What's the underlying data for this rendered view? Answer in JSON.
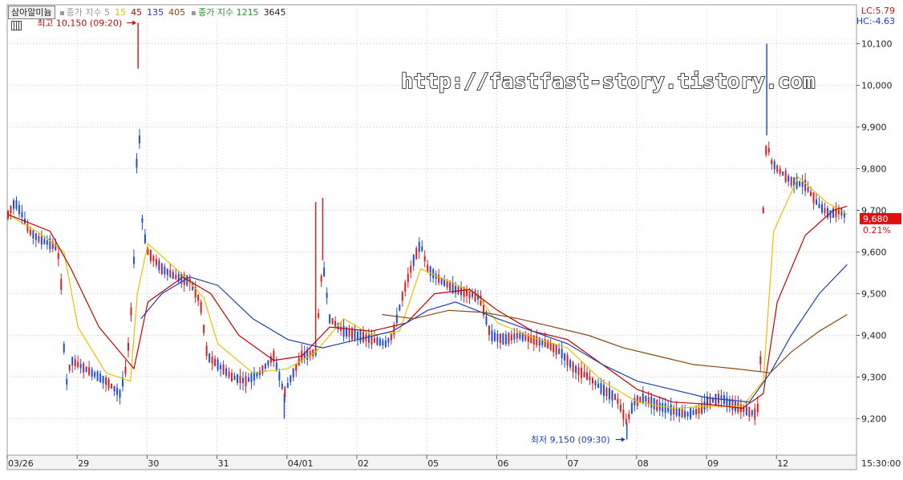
{
  "legend": {
    "symbol": "삼아알미늄",
    "items": [
      {
        "label": "종가 지수 5",
        "color": "#9a9a9a"
      },
      {
        "label": "15",
        "color": "#e6b800"
      },
      {
        "label": "45",
        "color": "#c00000"
      },
      {
        "label": "135",
        "color": "#1f3fb0"
      },
      {
        "label": "405",
        "color": "#8b4513"
      },
      {
        "label": "종가 지수 1215",
        "color": "#2e8b2e"
      },
      {
        "label": "3645",
        "color": "#222222"
      }
    ]
  },
  "indicators": {
    "lc": "LC:5.79",
    "hc": "HC:-4.63"
  },
  "current": {
    "price": "9,680",
    "change": "0.21%"
  },
  "annotations": {
    "high": "최고 10,150 (09:20)",
    "low": "최저 9,150 (09:30)"
  },
  "watermark": "http://fastfast-story.tistory.com",
  "time_label": "15:30:00",
  "colors": {
    "candle_up": "#d42020",
    "candle_down": "#1f4fd0",
    "ma5": "#b8860b",
    "ma15": "#e6c000",
    "ma45": "#c00000",
    "ma135": "#1f3fb0",
    "ma405": "#8b4513",
    "grid": "#c8c8c8",
    "price_box": "#e01010"
  },
  "chart_data": {
    "type": "line",
    "title": "",
    "xlabel": "",
    "ylabel": "",
    "ylim": [
      9130,
      10150
    ],
    "yticks": [
      "9,200",
      "9,300",
      "9,400",
      "9,500",
      "9,600",
      "9,700",
      "9,800",
      "9,900",
      "10,000",
      "10,100"
    ],
    "ytick_values": [
      9200,
      9300,
      9400,
      9500,
      9600,
      9700,
      9800,
      9900,
      10000,
      10100
    ],
    "xticks": [
      "03/26",
      "29",
      "30",
      "31",
      "04/01",
      "02",
      "05",
      "06",
      "07",
      "08",
      "09",
      "12"
    ],
    "xtick_positions": [
      0,
      1,
      2,
      3,
      4,
      5,
      6,
      7,
      8,
      9,
      10,
      11
    ],
    "x_end": 12.0,
    "grid": true,
    "price": [
      [
        0.0,
        9690
      ],
      [
        0.1,
        9720
      ],
      [
        0.2,
        9690
      ],
      [
        0.3,
        9650
      ],
      [
        0.45,
        9630
      ],
      [
        0.6,
        9620
      ],
      [
        0.7,
        9610
      ],
      [
        0.75,
        9560
      ],
      [
        0.8,
        9370
      ],
      [
        0.83,
        9280
      ],
      [
        0.9,
        9340
      ],
      [
        1.0,
        9330
      ],
      [
        1.2,
        9310
      ],
      [
        1.4,
        9290
      ],
      [
        1.6,
        9260
      ],
      [
        1.7,
        9330
      ],
      [
        1.78,
        9500
      ],
      [
        1.83,
        9700
      ],
      [
        1.86,
        10040
      ],
      [
        1.9,
        9700
      ],
      [
        1.95,
        9640
      ],
      [
        2.0,
        9600
      ],
      [
        2.2,
        9560
      ],
      [
        2.4,
        9540
      ],
      [
        2.6,
        9530
      ],
      [
        2.75,
        9480
      ],
      [
        2.85,
        9350
      ],
      [
        3.0,
        9330
      ],
      [
        3.2,
        9300
      ],
      [
        3.4,
        9290
      ],
      [
        3.6,
        9310
      ],
      [
        3.8,
        9350
      ],
      [
        3.95,
        9260
      ],
      [
        4.05,
        9300
      ],
      [
        4.2,
        9350
      ],
      [
        4.4,
        9360
      ],
      [
        4.5,
        9580
      ],
      [
        4.6,
        9440
      ],
      [
        4.8,
        9410
      ],
      [
        5.0,
        9400
      ],
      [
        5.2,
        9390
      ],
      [
        5.4,
        9380
      ],
      [
        5.5,
        9400
      ],
      [
        5.65,
        9500
      ],
      [
        5.8,
        9580
      ],
      [
        5.9,
        9620
      ],
      [
        6.0,
        9560
      ],
      [
        6.2,
        9530
      ],
      [
        6.4,
        9510
      ],
      [
        6.6,
        9500
      ],
      [
        6.75,
        9490
      ],
      [
        6.9,
        9400
      ],
      [
        7.1,
        9390
      ],
      [
        7.3,
        9400
      ],
      [
        7.5,
        9390
      ],
      [
        7.7,
        9380
      ],
      [
        7.9,
        9360
      ],
      [
        8.1,
        9320
      ],
      [
        8.3,
        9300
      ],
      [
        8.5,
        9270
      ],
      [
        8.7,
        9250
      ],
      [
        8.85,
        9190
      ],
      [
        8.95,
        9240
      ],
      [
        9.1,
        9250
      ],
      [
        9.3,
        9230
      ],
      [
        9.5,
        9220
      ],
      [
        9.7,
        9210
      ],
      [
        9.9,
        9220
      ],
      [
        10.0,
        9240
      ],
      [
        10.2,
        9250
      ],
      [
        10.4,
        9230
      ],
      [
        10.55,
        9220
      ],
      [
        10.7,
        9210
      ],
      [
        10.75,
        9250
      ],
      [
        10.8,
        9700
      ],
      [
        10.85,
        9880
      ],
      [
        10.9,
        9820
      ],
      [
        11.0,
        9800
      ],
      [
        11.2,
        9770
      ],
      [
        11.4,
        9760
      ],
      [
        11.6,
        9710
      ],
      [
        11.75,
        9690
      ],
      [
        11.9,
        9700
      ],
      [
        12.0,
        9680
      ]
    ],
    "series": [
      {
        "name": "15",
        "color": "#e6c000",
        "points": [
          [
            0.0,
            9690
          ],
          [
            0.5,
            9640
          ],
          [
            0.8,
            9600
          ],
          [
            1.0,
            9420
          ],
          [
            1.4,
            9310
          ],
          [
            1.75,
            9290
          ],
          [
            1.85,
            9500
          ],
          [
            2.0,
            9620
          ],
          [
            2.5,
            9545
          ],
          [
            2.8,
            9490
          ],
          [
            3.0,
            9380
          ],
          [
            3.5,
            9310
          ],
          [
            4.0,
            9320
          ],
          [
            4.4,
            9360
          ],
          [
            4.8,
            9440
          ],
          [
            5.2,
            9400
          ],
          [
            5.6,
            9410
          ],
          [
            5.9,
            9560
          ],
          [
            6.3,
            9530
          ],
          [
            6.7,
            9500
          ],
          [
            7.0,
            9430
          ],
          [
            7.5,
            9395
          ],
          [
            8.0,
            9370
          ],
          [
            8.5,
            9290
          ],
          [
            9.0,
            9240
          ],
          [
            9.5,
            9225
          ],
          [
            10.0,
            9230
          ],
          [
            10.5,
            9230
          ],
          [
            10.8,
            9290
          ],
          [
            10.95,
            9650
          ],
          [
            11.3,
            9780
          ],
          [
            11.7,
            9720
          ],
          [
            12.0,
            9690
          ]
        ]
      },
      {
        "name": "45",
        "color": "#c00000",
        "points": [
          [
            0.0,
            9690
          ],
          [
            0.6,
            9650
          ],
          [
            0.9,
            9560
          ],
          [
            1.3,
            9420
          ],
          [
            1.8,
            9320
          ],
          [
            2.0,
            9480
          ],
          [
            2.5,
            9540
          ],
          [
            2.9,
            9500
          ],
          [
            3.3,
            9400
          ],
          [
            3.8,
            9340
          ],
          [
            4.2,
            9350
          ],
          [
            4.6,
            9420
          ],
          [
            5.2,
            9410
          ],
          [
            5.7,
            9430
          ],
          [
            6.1,
            9500
          ],
          [
            6.6,
            9510
          ],
          [
            7.0,
            9460
          ],
          [
            7.5,
            9410
          ],
          [
            8.0,
            9390
          ],
          [
            8.5,
            9330
          ],
          [
            9.0,
            9270
          ],
          [
            9.5,
            9240
          ],
          [
            10.0,
            9235
          ],
          [
            10.5,
            9225
          ],
          [
            10.8,
            9260
          ],
          [
            11.0,
            9480
          ],
          [
            11.4,
            9640
          ],
          [
            11.8,
            9700
          ],
          [
            12.0,
            9710
          ]
        ]
      },
      {
        "name": "135",
        "color": "#1f3fb0",
        "points": [
          [
            1.9,
            9440
          ],
          [
            2.2,
            9500
          ],
          [
            2.6,
            9540
          ],
          [
            3.0,
            9520
          ],
          [
            3.5,
            9440
          ],
          [
            4.0,
            9390
          ],
          [
            4.5,
            9370
          ],
          [
            5.0,
            9390
          ],
          [
            5.5,
            9410
          ],
          [
            6.0,
            9460
          ],
          [
            6.4,
            9480
          ],
          [
            7.0,
            9440
          ],
          [
            7.5,
            9410
          ],
          [
            8.0,
            9380
          ],
          [
            8.5,
            9330
          ],
          [
            9.0,
            9290
          ],
          [
            9.5,
            9270
          ],
          [
            10.0,
            9250
          ],
          [
            10.6,
            9240
          ],
          [
            10.9,
            9310
          ],
          [
            11.2,
            9400
          ],
          [
            11.6,
            9500
          ],
          [
            12.0,
            9570
          ]
        ]
      },
      {
        "name": "405",
        "color": "#8b4513",
        "points": [
          [
            5.35,
            9450
          ],
          [
            5.8,
            9440
          ],
          [
            6.3,
            9460
          ],
          [
            6.8,
            9455
          ],
          [
            7.3,
            9440
          ],
          [
            7.8,
            9420
          ],
          [
            8.3,
            9400
          ],
          [
            8.8,
            9370
          ],
          [
            9.3,
            9350
          ],
          [
            9.8,
            9330
          ],
          [
            10.4,
            9320
          ],
          [
            10.9,
            9310
          ],
          [
            11.2,
            9360
          ],
          [
            11.6,
            9410
          ],
          [
            12.0,
            9450
          ]
        ]
      }
    ],
    "annotations": [
      {
        "text": "최고 10,150 (09:20)",
        "x": 1.86,
        "y": 10150
      },
      {
        "text": "최저 9,150 (09:30)",
        "x": 8.85,
        "y": 9150
      }
    ]
  }
}
